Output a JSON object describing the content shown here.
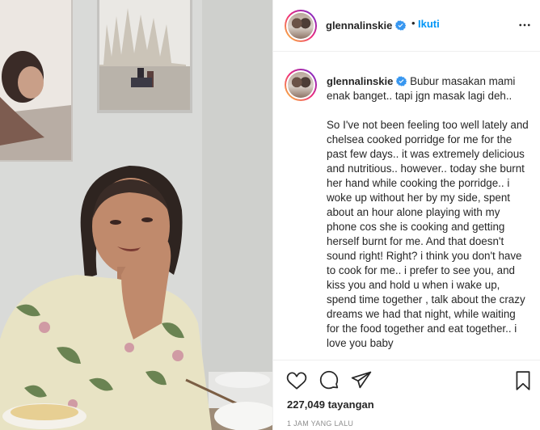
{
  "post": {
    "username": "glennalinskie",
    "dot": "•",
    "follow_label": "Ikuti",
    "caption_intro": "Bubur masakan mami enak banget.. tapi jgn masak lagi deh..",
    "caption_body": "So I've not been feeling too well lately and chelsea cooked porridge for me for the past few days.. it was extremely delicious and nutritious.. however.. today she burnt her hand while cooking the porridge.. i woke up without her by my side, spent about an hour alone playing with my phone cos she is cooking and getting herself burnt for me. And that doesn't sound right! Right? i think you don't have to cook for me.. i prefer to see you, and kiss you and hold u when i wake up, spend time together , talk about the crazy dreams we had that night, while waiting for the food together and eat together.. i love you baby",
    "views": "227,049 tayangan",
    "time": "1 JAM YANG LALU"
  },
  "icons": {
    "verified": "verified-badge-icon",
    "more": "more-options-icon",
    "like": "heart-icon",
    "comment": "comment-icon",
    "share": "share-icon",
    "save": "bookmark-icon"
  },
  "colors": {
    "link_blue": "#0095f6",
    "verified_blue": "#3897f0",
    "text": "#262626",
    "muted": "#8e8e8e"
  }
}
